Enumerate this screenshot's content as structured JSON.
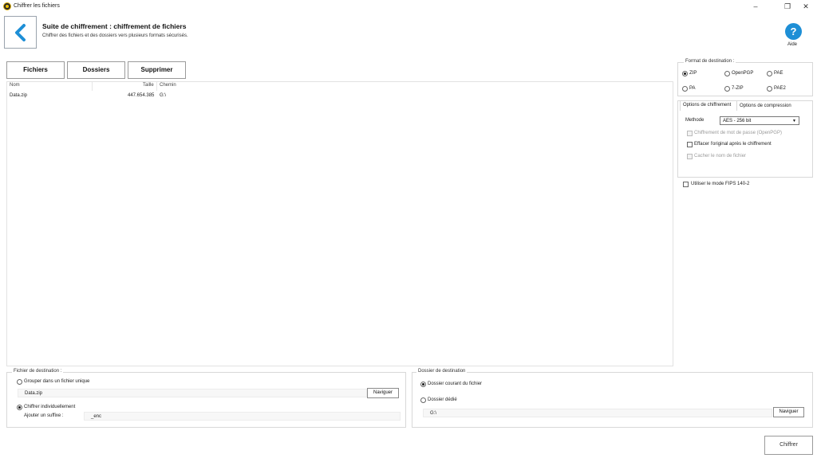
{
  "window": {
    "title": "Chiffrer les fichiers",
    "controls": [
      "–",
      "❐",
      "✕"
    ]
  },
  "header": {
    "title": "Suite de chiffrement : chiffrement de fichiers",
    "subtitle": "Chiffrer des fichiers et des dossiers vers plusieurs formats sécurisés.",
    "help_label": "Aide",
    "help_glyph": "?",
    "accent_color": "#1e8fd6"
  },
  "actions": {
    "files": "Fichiers",
    "folders": "Dossiers",
    "remove": "Supprimer"
  },
  "file_list": {
    "columns": [
      "Nom",
      "Taille",
      "Chemin"
    ],
    "rows": [
      {
        "name": "Data.zip",
        "size": "447.654.385",
        "path": "G:\\"
      }
    ]
  },
  "format": {
    "title": "Format de destination :",
    "options": [
      "ZIP",
      "OpenPGP",
      "PAE",
      "PA",
      "7-ZIP",
      "PAE2"
    ],
    "selected": "ZIP"
  },
  "options": {
    "tabs": [
      "Options de chiffrement",
      "Options de compression"
    ],
    "active_tab": "Options de chiffrement",
    "method_label": "Methode",
    "method_value": "AES - 256 bit",
    "pwd_encrypt": "Chiffrement de mot de passe (OpenPGP)",
    "delete_original": "Effacer l'original après le chiffrement",
    "hide_name": "Cacher le nom de fichier",
    "fips": "Utiliser le mode FIPS 140-2"
  },
  "dest_file": {
    "title": "Fichier de destination :",
    "group_label": "Grouper dans un fichier unique",
    "group_value": "Data.zip",
    "browse": "Naviguer",
    "individual_label": "Chiffrer individuellement",
    "suffix_label": "Ajouter un suffixe :",
    "suffix_value": "_enc",
    "selected": "individual"
  },
  "dest_folder": {
    "title": "Dossier de destination",
    "current_label": "Dossier courant du fichier",
    "dedicated_label": "Dossier dédié",
    "dedicated_value": "G:\\",
    "browse": "Naviguer",
    "selected": "current"
  },
  "footer": {
    "encrypt": "Chiffrer"
  }
}
